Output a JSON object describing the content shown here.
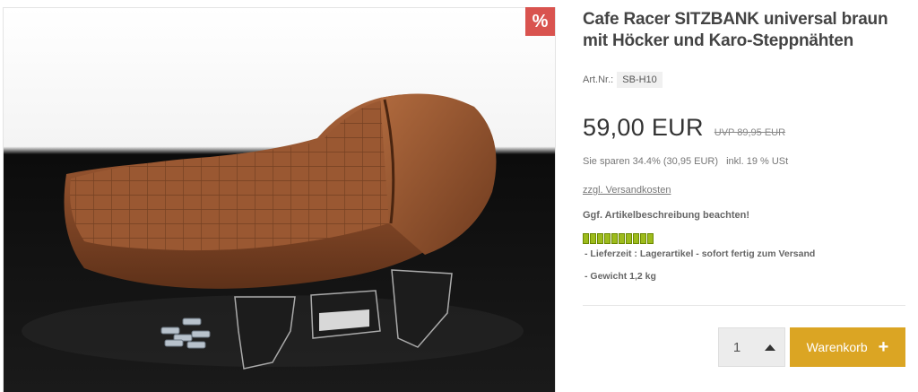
{
  "product": {
    "title": "Cafe Racer SITZBANK universal braun mit Höcker und Karo-Steppnähten",
    "sale_badge": "%",
    "art_nr_label": "Art.Nr.:",
    "art_nr_value": "SB-H10",
    "price": "59,00 EUR",
    "uvp": "UVP 89,95 EUR",
    "savings": "Sie sparen 34.4% (30,95 EUR)",
    "tax": "inkl. 19 % USt",
    "shipping_link": "zzgl. Versandkosten",
    "note": "Ggf. Artikelbeschreibung beachten!",
    "stock_segments": 10,
    "delivery": "- Lieferzeit : Lagerartikel - sofort fertig zum Versand",
    "weight": "- Gewicht 1,2 kg"
  },
  "cart": {
    "quantity": "1",
    "button_label": "Warenkorb"
  },
  "colors": {
    "sale": "#d9534f",
    "cart_button": "#dba523",
    "stock": "#9dbb1c"
  },
  "icons": {
    "qty_up": "caret-up-icon",
    "cart_plus": "plus-icon"
  }
}
